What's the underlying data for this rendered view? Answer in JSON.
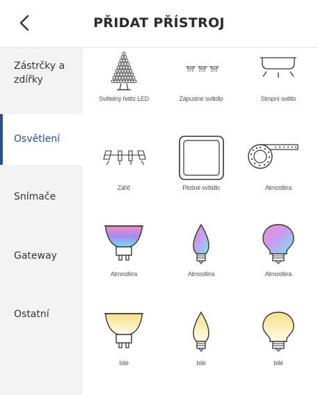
{
  "header": {
    "title": "PŘIDAT PŘÍSTROJ",
    "back_icon": "chevron-left-icon"
  },
  "sidebar": {
    "items": [
      {
        "label": "Zástrčky a\nzdířky",
        "active": false
      },
      {
        "label": "Osvětlení",
        "active": true
      },
      {
        "label": "Snímače",
        "active": false
      },
      {
        "label": "Gateway",
        "active": false
      },
      {
        "label": "Ostatní",
        "active": false
      }
    ]
  },
  "devices": [
    {
      "label": "Světelný řetěz LED",
      "icon": "led-string-tree-icon"
    },
    {
      "label": "Zápustné svítidlo",
      "icon": "recessed-lights-icon"
    },
    {
      "label": "Stropní světlo",
      "icon": "ceiling-light-icon"
    },
    {
      "label": "Zářič",
      "icon": "spotlight-bar-icon"
    },
    {
      "label": "Plošné svítidlo",
      "icon": "panel-light-icon"
    },
    {
      "label": "Atmosféra",
      "icon": "led-strip-reel-icon"
    },
    {
      "label": "Atmosféra",
      "icon": "gu10-color-bulb-icon"
    },
    {
      "label": "Atmosféra",
      "icon": "candle-color-bulb-icon"
    },
    {
      "label": "Atmosféra",
      "icon": "classic-color-bulb-icon"
    },
    {
      "label": "bílé",
      "icon": "gu10-white-bulb-icon"
    },
    {
      "label": "bílé",
      "icon": "candle-white-bulb-icon"
    },
    {
      "label": "bílé",
      "icon": "classic-white-bulb-icon"
    }
  ],
  "colors": {
    "accent": "#2a4f8f",
    "sidebar_bg": "#f3f3f3",
    "outline": "#333333",
    "warm_white": "#fbe9a8"
  }
}
